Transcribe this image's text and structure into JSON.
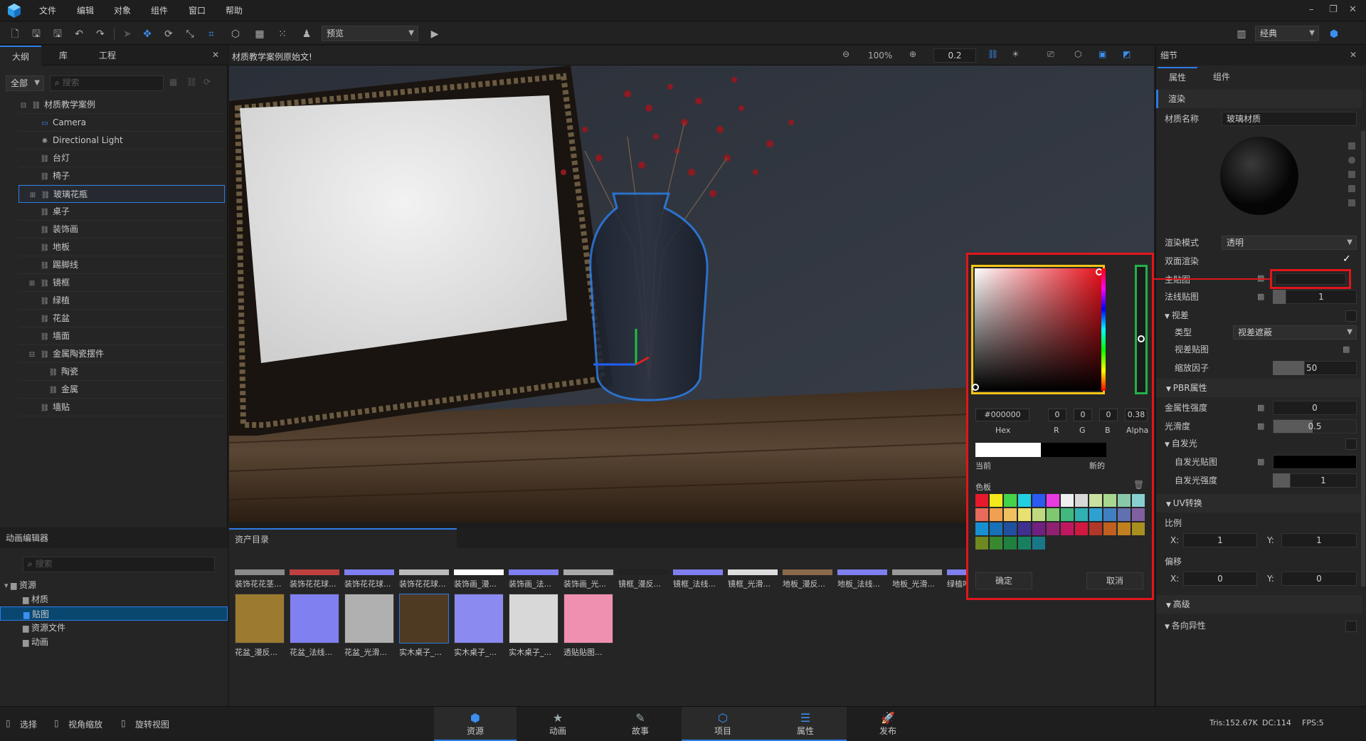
{
  "menu": [
    "文件",
    "编辑",
    "对象",
    "组件",
    "窗口",
    "帮助"
  ],
  "toolbar": {
    "preview_select": "预览",
    "layout_select": "经典"
  },
  "left_panel": {
    "tabs": [
      "大纲",
      "库",
      "工程"
    ],
    "filter": "全部",
    "search_placeholder": "搜索",
    "tree": [
      {
        "label": "材质教学案例",
        "indent": 0,
        "expander": "⊟"
      },
      {
        "label": "Camera",
        "indent": 1,
        "icon": "camera-icon"
      },
      {
        "label": "Directional Light",
        "indent": 1,
        "icon": "light-icon"
      },
      {
        "label": "台灯",
        "indent": 1
      },
      {
        "label": "椅子",
        "indent": 1
      },
      {
        "label": "玻璃花瓶",
        "indent": 1,
        "expander": "⊞",
        "selected": true
      },
      {
        "label": "桌子",
        "indent": 1
      },
      {
        "label": "装饰画",
        "indent": 1
      },
      {
        "label": "地板",
        "indent": 1
      },
      {
        "label": "踢脚线",
        "indent": 1
      },
      {
        "label": "镜框",
        "indent": 1,
        "expander": "⊞"
      },
      {
        "label": "绿植",
        "indent": 1
      },
      {
        "label": "花盆",
        "indent": 1
      },
      {
        "label": "墙面",
        "indent": 1
      },
      {
        "label": "金属陶瓷摆件",
        "indent": 1,
        "expander": "⊟"
      },
      {
        "label": "陶瓷",
        "indent": 2
      },
      {
        "label": "金属",
        "indent": 2
      },
      {
        "label": "墙贴",
        "indent": 1
      }
    ]
  },
  "viewport": {
    "tab_title": "材质教学案例原始文!",
    "zoom": "100%",
    "snap": "0.2"
  },
  "anim_editor": {
    "title": "动画编辑器",
    "search_placeholder": "搜索",
    "folders": [
      {
        "label": "资源",
        "indent": 0
      },
      {
        "label": "材质",
        "indent": 1
      },
      {
        "label": "贴图",
        "indent": 1,
        "selected": true
      },
      {
        "label": "资源文件",
        "indent": 1
      },
      {
        "label": "动画",
        "indent": 1
      }
    ]
  },
  "assets": {
    "title": "资产目录",
    "row1": [
      "装饰花花茎...",
      "装饰花花球...",
      "装饰花花球...",
      "装饰花花球...",
      "装饰画_漫...",
      "装饰画_法...",
      "装饰画_光...",
      "镜框_漫反...",
      "镜框_法线...",
      "镜框_光滑...",
      "地板_漫反...",
      "地板_法线...",
      "地板_光滑...",
      "绿植叶"
    ],
    "row1_colors": [
      "#8a8a8a",
      "#c04040",
      "#7f7ff0",
      "#bbbbbb",
      "#ffffff",
      "#7f7ff0",
      "#aaaaaa",
      "#222222",
      "#7f7ff0",
      "#dddddd",
      "#8a6a4a",
      "#7f7ff0",
      "#999999",
      "#7f7ff0"
    ],
    "row2": [
      "花盆_漫反...",
      "花盆_法线...",
      "花盆_光滑...",
      "实木桌子_...",
      "实木桌子_...",
      "实木桌子_...",
      "透贴贴图..."
    ],
    "row2_colors": [
      "#9c7a30",
      "#8080f0",
      "#b0b0b0",
      "#4e3a22",
      "#8a8af0",
      "#d8d8d8",
      "#f090b0"
    ]
  },
  "details": {
    "title": "细节",
    "tabs": [
      "属性",
      "组件"
    ],
    "render_section": "渲染",
    "material_name_label": "材质名称",
    "material_name": "玻璃材质",
    "render_mode_label": "渲染模式",
    "render_mode": "透明",
    "double_sided_label": "双面渲染",
    "main_map_label": "主贴图",
    "normal_map_label": "法线贴图",
    "normal_map_value": "1",
    "parallax_label": "视差",
    "type_label": "类型",
    "type_value": "视差遮蔽",
    "parallax_map_label": "视差贴图",
    "scale_factor_label": "缩放因子",
    "scale_factor_value": "50",
    "pbr_section": "PBR属性",
    "metallic_label": "金属性强度",
    "metallic_value": "0",
    "smoothness_label": "光滑度",
    "smoothness_value": "0.5",
    "emissive_label": "自发光",
    "emissive_map_label": "自发光贴图",
    "emissive_strength_label": "自发光强度",
    "emissive_strength_value": "1",
    "uv_section": "UV转换",
    "scale_label": "比例",
    "scale_x": "1",
    "scale_y": "1",
    "offset_label": "偏移",
    "offset_x": "0",
    "offset_y": "0",
    "x_label": "X:",
    "y_label": "Y:",
    "advanced_section": "高级",
    "anisotropy_label": "各向异性"
  },
  "color_picker": {
    "hex": "#000000",
    "r": "0",
    "g": "0",
    "b": "0",
    "alpha": "0.38",
    "hex_label": "Hex",
    "r_label": "R",
    "g_label": "G",
    "b_label": "B",
    "alpha_label": "Alpha",
    "current_label": "当前",
    "new_label": "新的",
    "palette_label": "色板",
    "confirm": "确定",
    "cancel": "取消",
    "palette": [
      "#e8192c",
      "#f5e81a",
      "#44d24a",
      "#22cfe0",
      "#2a5af0",
      "#e83ae0",
      "#f0f0f0",
      "#d8d8d8",
      "#c8e0a0",
      "#a8d890",
      "#88c8a8",
      "#88d0d0",
      "#e86a5a",
      "#f0a050",
      "#f0c060",
      "#e8e070",
      "#c0d880",
      "#80c870",
      "#40b880",
      "#30b0b0",
      "#30a0d0",
      "#4080c0",
      "#6070b0",
      "#8060a0",
      "#1890d0",
      "#1870b8",
      "#2050a0",
      "#403090",
      "#702080",
      "#902070",
      "#c01860",
      "#d01840",
      "#b03828",
      "#c06020",
      "#c08020",
      "#a89020",
      "#708820",
      "#388830",
      "#208040",
      "#188060",
      "#187888"
    ]
  },
  "statusbar": {
    "tools": [
      "选择",
      "视角缩放",
      "旋转视图"
    ],
    "tabs": [
      "资源",
      "动画",
      "故事",
      "项目",
      "属性",
      "发布"
    ],
    "tris": "Tris:152.67K",
    "dc": "DC:114",
    "fps": "FPS:5"
  }
}
